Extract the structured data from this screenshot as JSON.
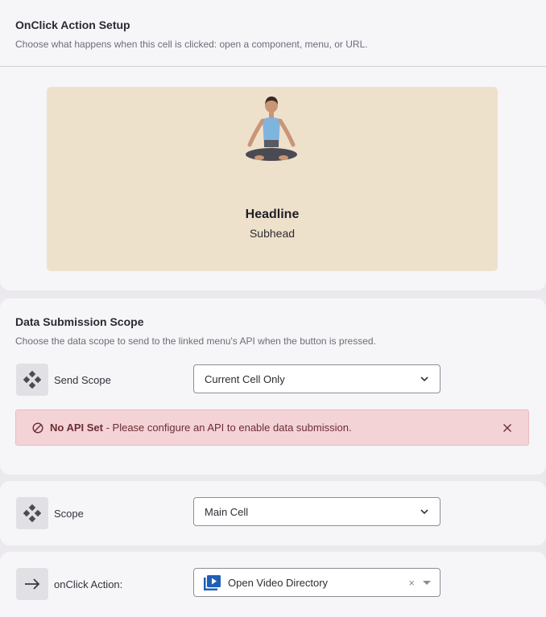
{
  "onclick_setup": {
    "title": "OnClick Action Setup",
    "description": "Choose what happens when this cell is clicked: open a component, menu, or URL.",
    "preview": {
      "headline": "Headline",
      "subhead": "Subhead",
      "image_icon": "meditating-woman-photo"
    }
  },
  "data_scope": {
    "title": "Data Submission Scope",
    "description": "Choose the data scope to send to the linked menu's API when the button is pressed.",
    "send_scope": {
      "icon": "diamond-grid-icon",
      "label": "Send Scope",
      "value": "Current Cell Only"
    },
    "alert": {
      "bold": "No API Set",
      "message": " - Please configure an API to enable data submission."
    }
  },
  "scope": {
    "icon": "diamond-grid-icon",
    "label": "Scope",
    "value": "Main Cell"
  },
  "onclick_action": {
    "icon": "arrow-right-icon",
    "label": "onClick Action:",
    "value": "Open Video Directory",
    "clear": "×"
  },
  "colors": {
    "alert_bg": "#f4d3d6",
    "preview_bg": "#eee1cc",
    "video_icon": "#1f5fb8"
  }
}
